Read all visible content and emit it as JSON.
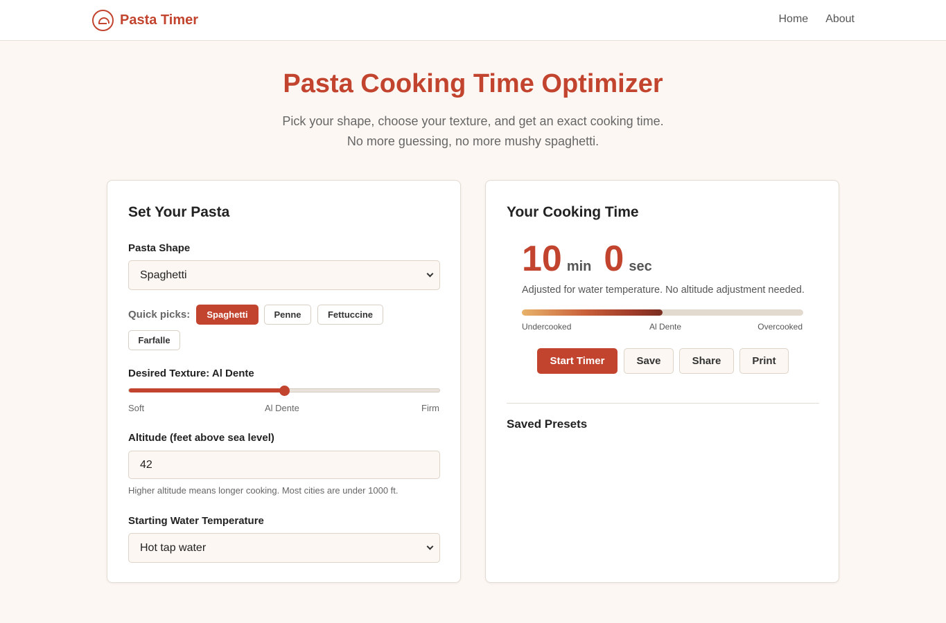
{
  "header": {
    "brand": "Pasta Timer",
    "nav": [
      "Home",
      "About"
    ]
  },
  "hero": {
    "title": "Pasta Cooking Time Optimizer",
    "subtitle_line1": "Pick your shape, choose your texture, and get an exact cooking time.",
    "subtitle_line2": "No more guessing, no more mushy spaghetti."
  },
  "setup": {
    "title": "Set Your Pasta",
    "shape_label": "Pasta Shape",
    "shape_value": "Spaghetti",
    "quick_label": "Quick picks:",
    "quick_picks": [
      "Spaghetti",
      "Penne",
      "Fettuccine",
      "Farfalle"
    ],
    "quick_active": "Spaghetti",
    "texture_label": "Desired Texture: Al Dente",
    "texture_level": 0.5,
    "texture_ticks": [
      "Soft",
      "Al Dente",
      "Firm"
    ],
    "altitude_label": "Altitude (feet above sea level)",
    "altitude_value": "42",
    "altitude_hint": "Higher altitude means longer cooking. Most cities are under 1000 ft.",
    "water_label": "Starting Water Temperature",
    "water_value": "Hot tap water"
  },
  "result": {
    "title": "Your Cooking Time",
    "minutes": "10",
    "min_unit": "min",
    "seconds": "0",
    "sec_unit": "sec",
    "note": "Adjusted for water temperature. No altitude adjustment needed.",
    "doneness_level": 0.5,
    "doneness_labels": [
      "Undercooked",
      "Al Dente",
      "Overcooked"
    ],
    "buttons": {
      "start": "Start Timer",
      "save": "Save",
      "share": "Share",
      "print": "Print"
    },
    "presets_title": "Saved Presets"
  },
  "colors": {
    "accent": "#c2442e",
    "background": "#fcf7f2"
  }
}
